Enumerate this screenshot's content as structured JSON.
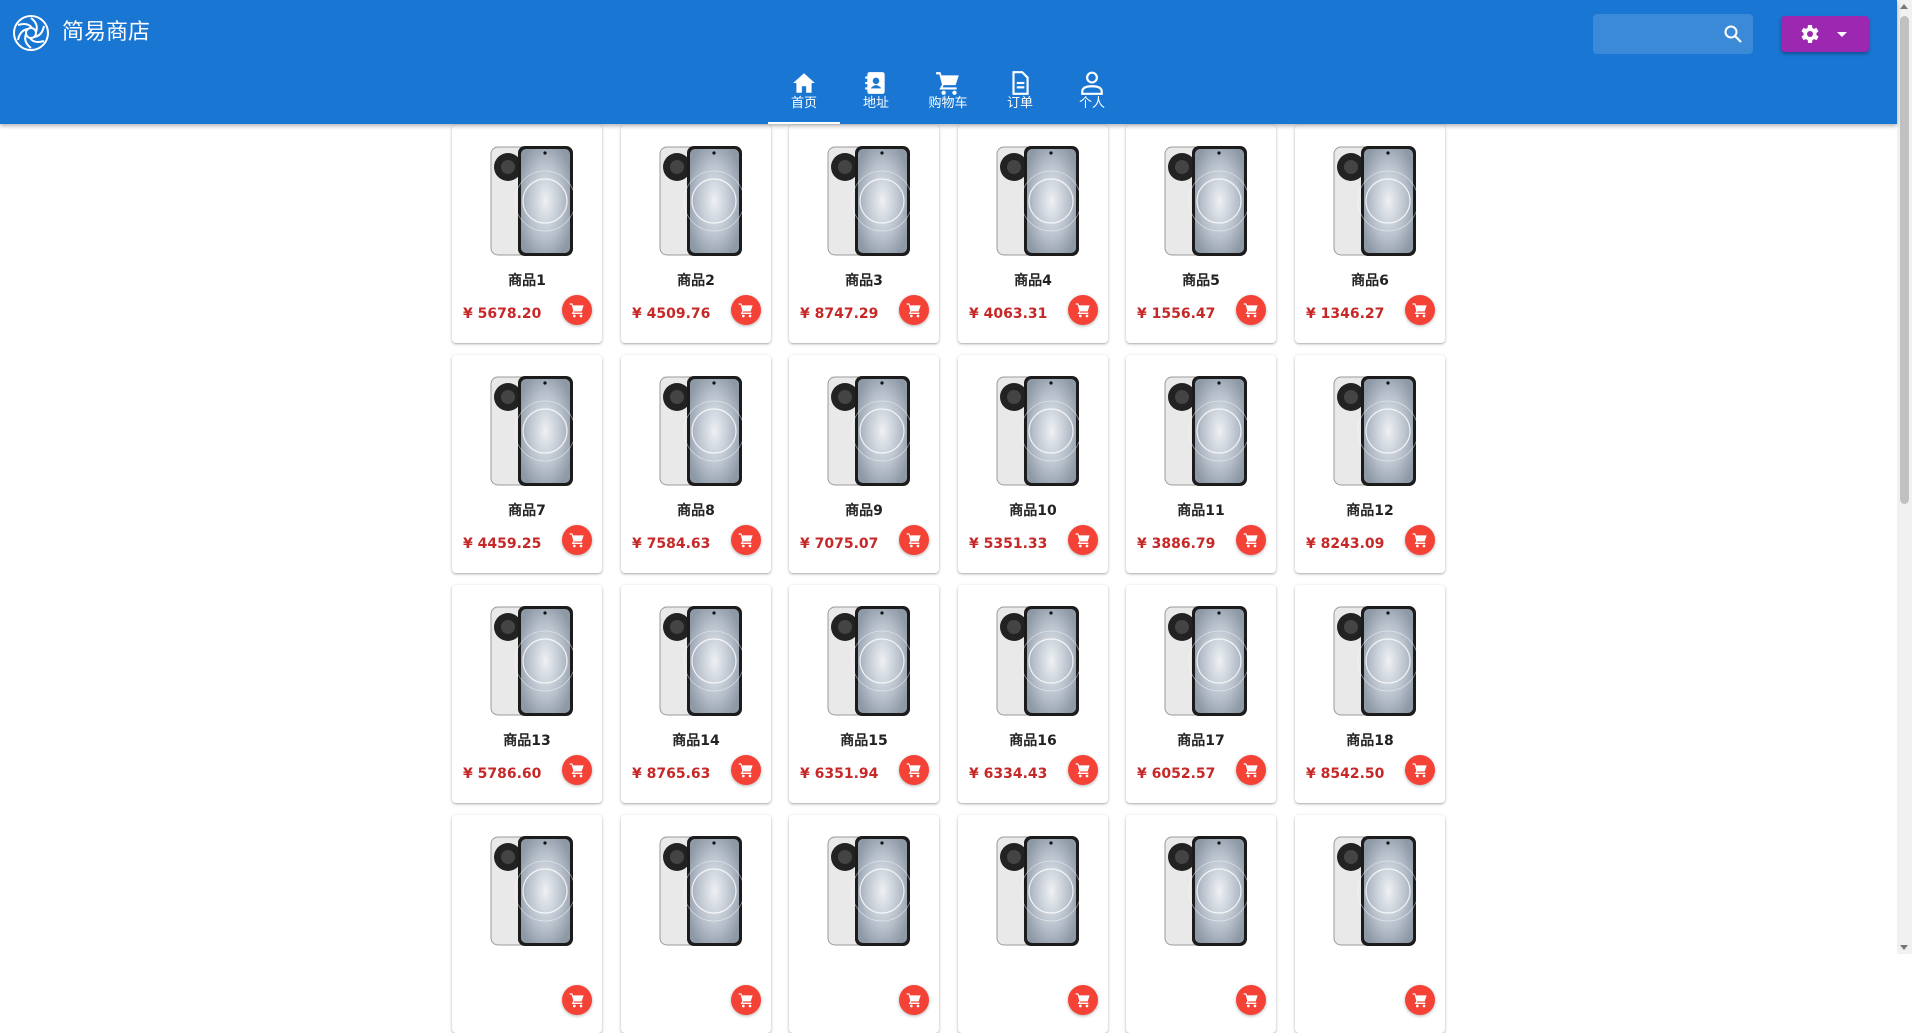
{
  "app": {
    "title": "简易商店",
    "logo_icon": "aperture-logo-icon"
  },
  "header": {
    "search": {
      "placeholder": "",
      "value": "",
      "icon": "search-icon"
    },
    "settings_button": {
      "icon": "gear-icon",
      "dropdown_icon": "caret-down-icon"
    }
  },
  "nav": [
    {
      "label": "首页",
      "icon": "home-icon",
      "active": true
    },
    {
      "label": "地址",
      "icon": "contact-book-icon",
      "active": false
    },
    {
      "label": "购物车",
      "icon": "cart-icon",
      "active": false
    },
    {
      "label": "订单",
      "icon": "document-icon",
      "active": false
    },
    {
      "label": "个人",
      "icon": "person-icon",
      "active": false
    }
  ],
  "products": [
    {
      "name": "商品1",
      "price": "¥ 5678.20"
    },
    {
      "name": "商品2",
      "price": "¥ 4509.76"
    },
    {
      "name": "商品3",
      "price": "¥ 8747.29"
    },
    {
      "name": "商品4",
      "price": "¥ 4063.31"
    },
    {
      "name": "商品5",
      "price": "¥ 1556.47"
    },
    {
      "name": "商品6",
      "price": "¥ 1346.27"
    },
    {
      "name": "商品7",
      "price": "¥ 4459.25"
    },
    {
      "name": "商品8",
      "price": "¥ 7584.63"
    },
    {
      "name": "商品9",
      "price": "¥ 7075.07"
    },
    {
      "name": "商品10",
      "price": "¥ 5351.33"
    },
    {
      "name": "商品11",
      "price": "¥ 3886.79"
    },
    {
      "name": "商品12",
      "price": "¥ 8243.09"
    },
    {
      "name": "商品13",
      "price": "¥ 5786.60"
    },
    {
      "name": "商品14",
      "price": "¥ 8765.63"
    },
    {
      "name": "商品15",
      "price": "¥ 6351.94"
    },
    {
      "name": "商品16",
      "price": "¥ 6334.43"
    },
    {
      "name": "商品17",
      "price": "¥ 6052.57"
    },
    {
      "name": "商品18",
      "price": "¥ 8542.50"
    },
    {
      "name": "",
      "price": ""
    },
    {
      "name": "",
      "price": ""
    },
    {
      "name": "",
      "price": ""
    },
    {
      "name": "",
      "price": ""
    },
    {
      "name": "",
      "price": ""
    },
    {
      "name": "",
      "price": ""
    }
  ],
  "colors": {
    "appbar": "#1976d2",
    "settings_button": "#9c27b0",
    "cart_button": "#f44336",
    "price": "#c62828"
  }
}
